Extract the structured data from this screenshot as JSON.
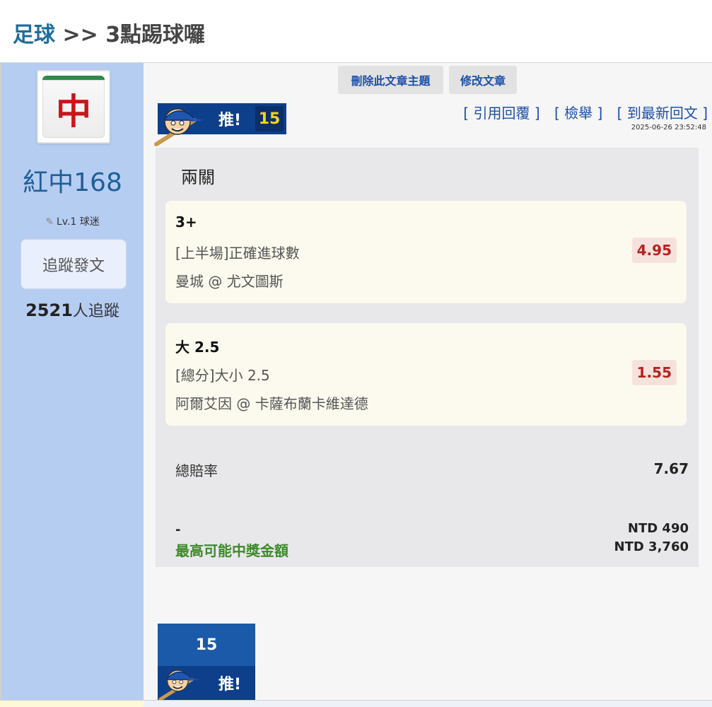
{
  "breadcrumb": {
    "section": "足球",
    "separator": ">>",
    "title": "3點踢球囉"
  },
  "user": {
    "name": "紅中168",
    "level": "Lv.1 球迷",
    "follow_button": "追蹤發文",
    "followers_count": "2521",
    "followers_suffix": "人追蹤",
    "avatar_icon": "mahjong-red-dragon-icon",
    "avatar_glyph": "中"
  },
  "admin": {
    "delete_label": "刪除此文章主題",
    "edit_label": "修改文章"
  },
  "post": {
    "push_label": "推!",
    "push_count": "15",
    "actions": {
      "quote": "[ 引用回覆 ]",
      "report": "[ 檢舉 ]",
      "latest": "[ 到最新回文 ]"
    },
    "timestamp": "2025-06-26 23:52:48"
  },
  "bet": {
    "type": "兩關",
    "legs": [
      {
        "pick": "3+",
        "market": "[上半場]正確進球數",
        "match": "曼城 @ 尤文圖斯",
        "odds": "4.95"
      },
      {
        "pick": "大 2.5",
        "market": "[總分]大小 2.5",
        "match": "阿爾艾因 @ 卡薩布蘭卡維達德",
        "odds": "1.55"
      }
    ],
    "total_odds_label": "總賠率",
    "total_odds": "7.67",
    "stake_label": "-",
    "stake": "NTD 490",
    "max_payout_label": "最高可能中獎金額",
    "max_payout": "NTD 3,760"
  },
  "footer_push": {
    "count": "15",
    "label": "推!"
  },
  "colors": {
    "brand_blue": "#0e3f8a",
    "sidebar_bg": "#b6cdf2",
    "odds_red": "#b4231f",
    "payout_green": "#3d8a2a",
    "link_blue": "#1d4fa8"
  }
}
